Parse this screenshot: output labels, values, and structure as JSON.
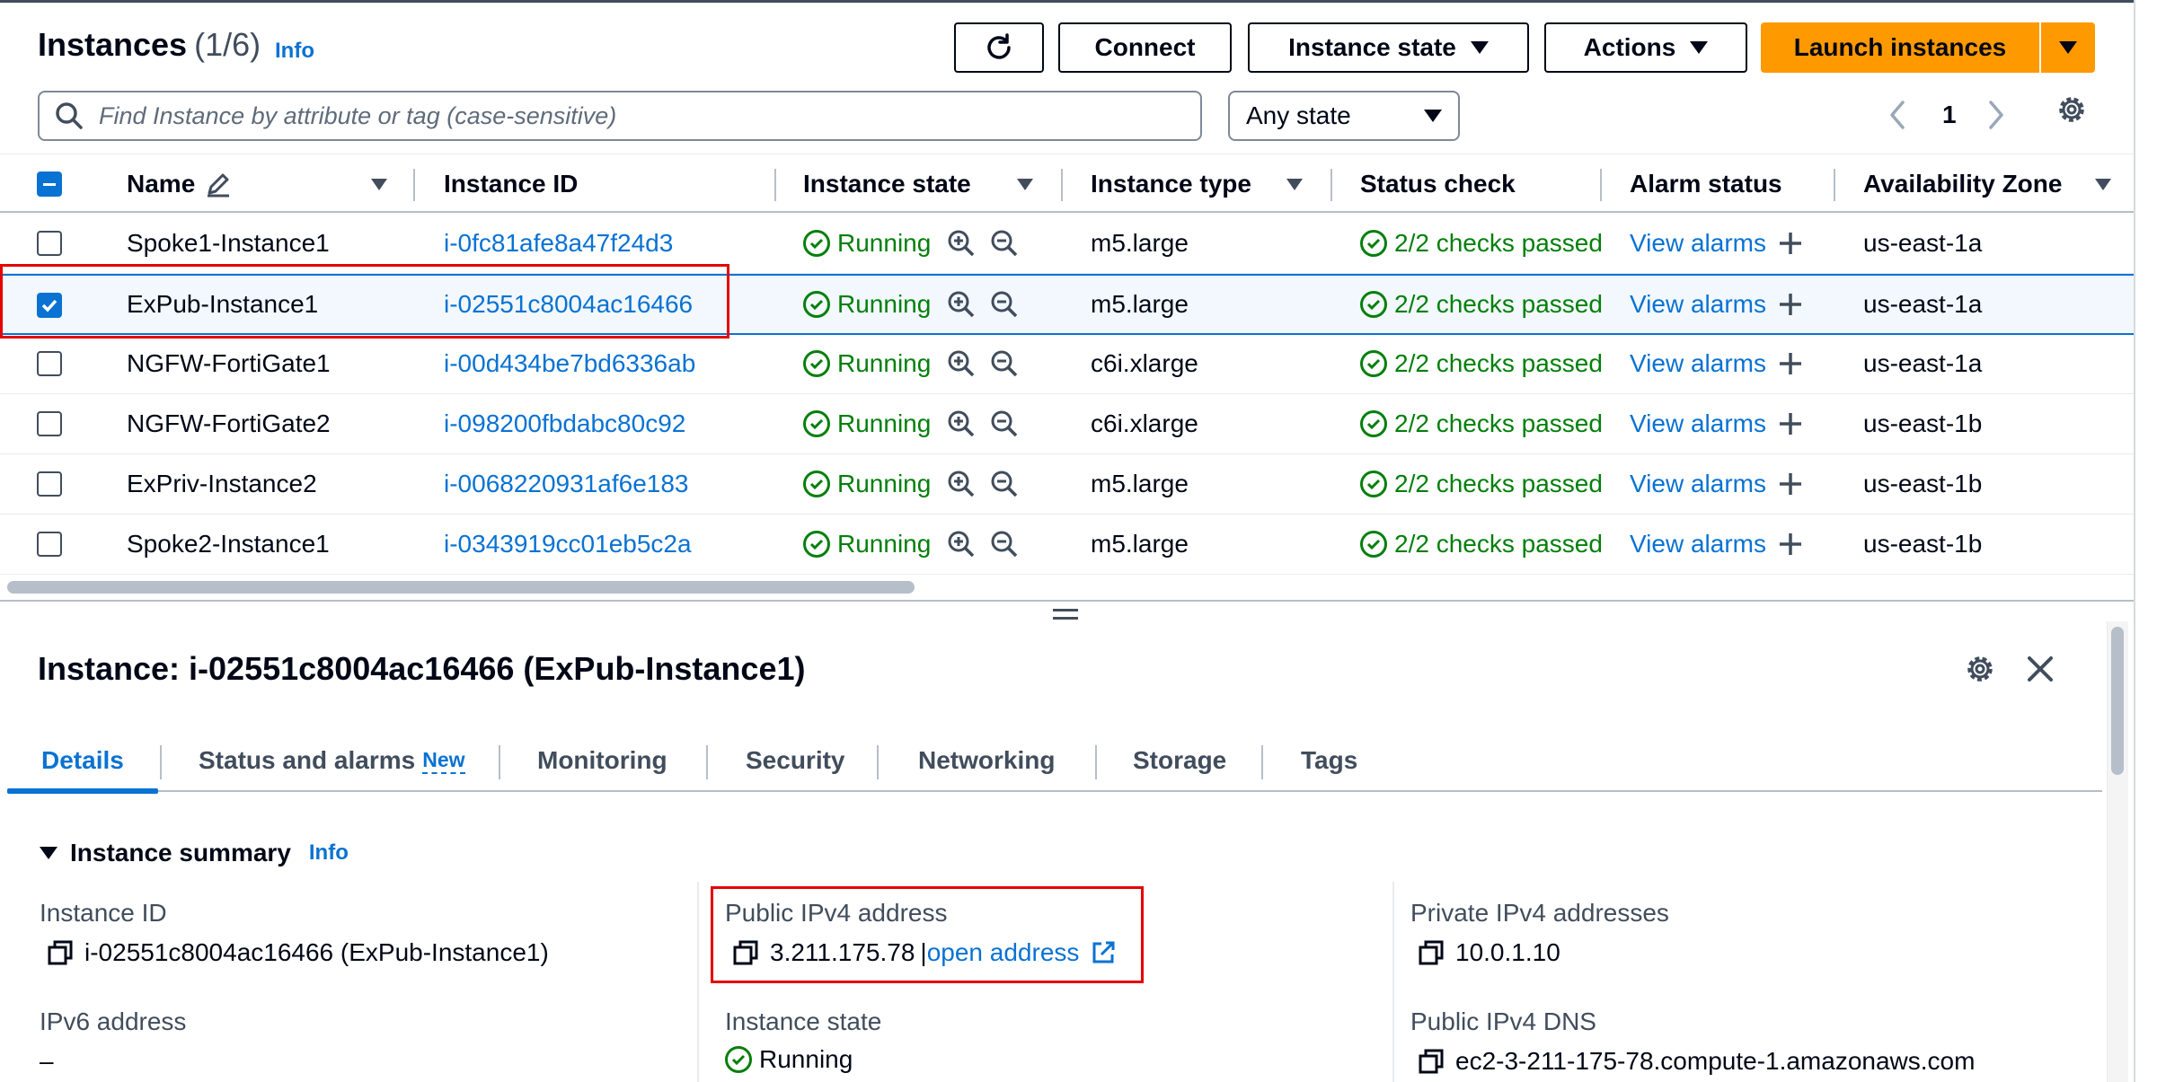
{
  "header": {
    "title": "Instances",
    "count": "(1/6)",
    "info": "Info"
  },
  "toolbar": {
    "connect": "Connect",
    "instance_state": "Instance state",
    "actions": "Actions",
    "launch": "Launch instances"
  },
  "search": {
    "placeholder": "Find Instance by attribute or tag (case-sensitive)"
  },
  "state_filter": {
    "value": "Any state"
  },
  "pagination": {
    "page": "1"
  },
  "columns": [
    "Name",
    "Instance ID",
    "Instance state",
    "Instance type",
    "Status check",
    "Alarm status",
    "Availability Zone"
  ],
  "rows": [
    {
      "name": "Spoke1-Instance1",
      "id": "i-0fc81afe8a47f24d3",
      "state": "Running",
      "type": "m5.large",
      "status": "2/2 checks passed",
      "alarm": "View alarms",
      "az": "us-east-1a",
      "selected": false
    },
    {
      "name": "ExPub-Instance1",
      "id": "i-02551c8004ac16466",
      "state": "Running",
      "type": "m5.large",
      "status": "2/2 checks passed",
      "alarm": "View alarms",
      "az": "us-east-1a",
      "selected": true
    },
    {
      "name": "NGFW-FortiGate1",
      "id": "i-00d434be7bd6336ab",
      "state": "Running",
      "type": "c6i.xlarge",
      "status": "2/2 checks passed",
      "alarm": "View alarms",
      "az": "us-east-1a",
      "selected": false
    },
    {
      "name": "NGFW-FortiGate2",
      "id": "i-098200fbdabc80c92",
      "state": "Running",
      "type": "c6i.xlarge",
      "status": "2/2 checks passed",
      "alarm": "View alarms",
      "az": "us-east-1b",
      "selected": false
    },
    {
      "name": "ExPriv-Instance2",
      "id": "i-0068220931af6e183",
      "state": "Running",
      "type": "m5.large",
      "status": "2/2 checks passed",
      "alarm": "View alarms",
      "az": "us-east-1b",
      "selected": false
    },
    {
      "name": "Spoke2-Instance1",
      "id": "i-0343919cc01eb5c2a",
      "state": "Running",
      "type": "m5.large",
      "status": "2/2 checks passed",
      "alarm": "View alarms",
      "az": "us-east-1b",
      "selected": false
    }
  ],
  "details": {
    "title": "Instance: i-02551c8004ac16466 (ExPub-Instance1)",
    "tabs": [
      "Details",
      "Status and alarms",
      "Monitoring",
      "Security",
      "Networking",
      "Storage",
      "Tags"
    ],
    "new_badge": "New",
    "summary_title": "Instance summary",
    "summary_info": "Info",
    "fields": {
      "instance_id_label": "Instance ID",
      "instance_id_value": "i-02551c8004ac16466 (ExPub-Instance1)",
      "public_ipv4_label": "Public IPv4 address",
      "public_ipv4_value": "3.211.175.78",
      "open_address": "open address",
      "private_ipv4_label": "Private IPv4 addresses",
      "private_ipv4_value": "10.0.1.10",
      "ipv6_label": "IPv6 address",
      "ipv6_value": "–",
      "instance_state_label": "Instance state",
      "instance_state_value": "Running",
      "public_dns_label": "Public IPv4 DNS",
      "public_dns_value": "ec2-3-211-175-78.compute-1.amazonaws.com"
    }
  },
  "colors": {
    "accent": "#0972d3",
    "primary_button": "#ff9900",
    "success": "#037f0c",
    "highlight": "#e60000"
  }
}
